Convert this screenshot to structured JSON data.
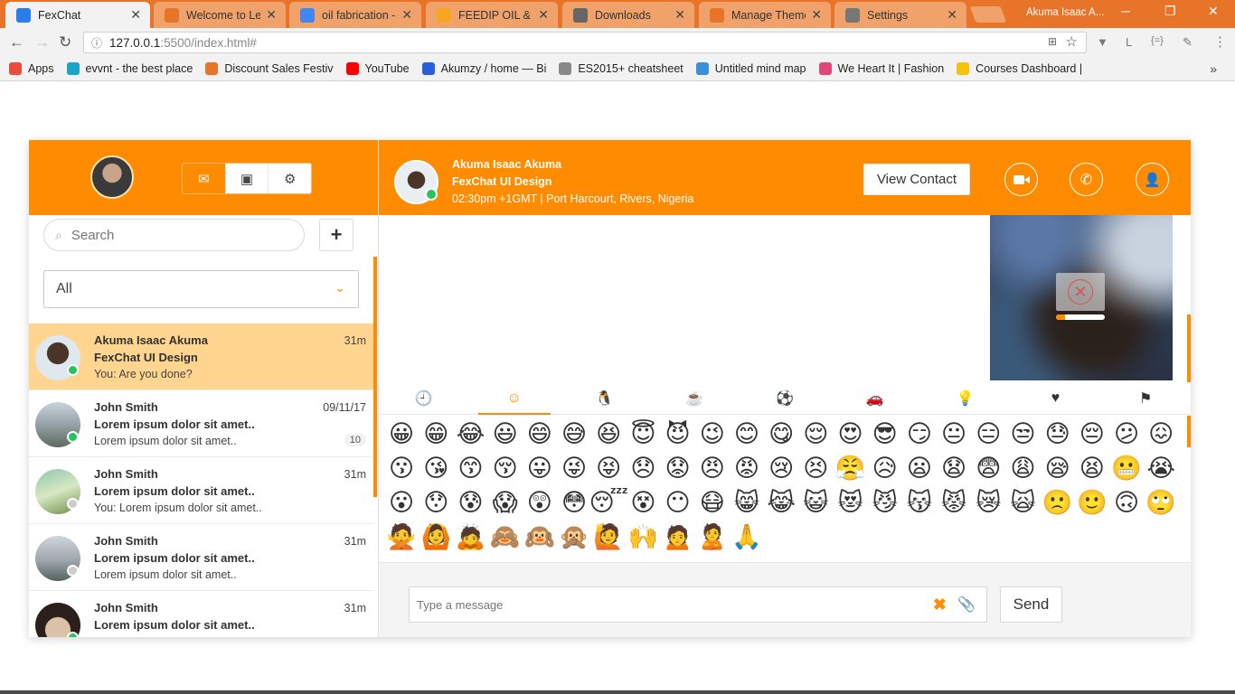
{
  "browser": {
    "tabs": [
      {
        "title": "FexChat",
        "color": "#2b7de9",
        "icon": "document-icon",
        "active": true
      },
      {
        "title": "Welcome to Lee",
        "color": "#e8742a",
        "icon": "brackets-icon"
      },
      {
        "title": "oil fabrication - G",
        "color": "#4285f4",
        "icon": "google-icon"
      },
      {
        "title": "FEEDIP OIL & GA",
        "color": "#f5a623",
        "icon": "feedip-icon"
      },
      {
        "title": "Downloads",
        "color": "#666666",
        "icon": "download-icon"
      },
      {
        "title": "Manage Themes",
        "color": "#e8742a",
        "icon": "brackets-icon"
      },
      {
        "title": "Settings",
        "color": "#777777",
        "icon": "gear-icon"
      }
    ],
    "profile": "Akuma Isaac A...",
    "url_host": "127.0.0.1",
    "url_path": ":5500/index.html#",
    "bookmarks": [
      {
        "label": "Apps",
        "color": "#e74c3c"
      },
      {
        "label": "evvnt - the best place",
        "color": "#1aa5c8"
      },
      {
        "label": "Discount Sales Festiv",
        "color": "#e8742a"
      },
      {
        "label": "YouTube",
        "color": "#ff0000"
      },
      {
        "label": "Akumzy / home — Bi",
        "color": "#2b5fd9"
      },
      {
        "label": "ES2015+ cheatsheet",
        "color": "#888888"
      },
      {
        "label": "Untitled mind map",
        "color": "#3a8fd6"
      },
      {
        "label": "We Heart It | Fashion",
        "color": "#e0457b"
      },
      {
        "label": "Courses Dashboard |",
        "color": "#f4c20d"
      }
    ]
  },
  "sidebar": {
    "search_placeholder": "Search",
    "filter_value": "All",
    "add_label": "+",
    "conversations": [
      {
        "name": "Akuma Isaac Akuma",
        "subject": "FexChat UI Design",
        "preview": "You: Are you done?",
        "time": "31m",
        "online": true,
        "selected": true,
        "count": ""
      },
      {
        "name": "John Smith",
        "subject": "Lorem ipsum dolor sit amet..",
        "preview": "Lorem ipsum dolor sit amet..",
        "time": "09/11/17",
        "online": true,
        "selected": false,
        "count": "10"
      },
      {
        "name": "John Smith",
        "subject": "Lorem ipsum dolor sit amet..",
        "preview": "You: Lorem ipsum dolor sit amet..",
        "time": "31m",
        "online": false,
        "selected": false,
        "count": ""
      },
      {
        "name": "John Smith",
        "subject": "Lorem ipsum dolor sit amet..",
        "preview": "Lorem ipsum dolor sit amet..",
        "time": "31m",
        "online": false,
        "selected": false,
        "count": ""
      },
      {
        "name": "John Smith",
        "subject": "Lorem ipsum dolor sit amet..",
        "preview": "",
        "time": "31m",
        "online": true,
        "selected": false,
        "count": ""
      }
    ]
  },
  "chat": {
    "contact_name": "Akuma Isaac Akuma",
    "contact_subject": "FexChat UI Design",
    "contact_time": "02:30pm +1GMT | Port Harcourt, Rivers, Nigeria",
    "view_contact_label": "View Contact",
    "video_progress": 0.18,
    "emoji_tabs": [
      "clock-icon",
      "smiley-icon",
      "animal-icon",
      "food-icon",
      "ball-icon",
      "car-icon",
      "bulb-icon",
      "heart-icon",
      "flag-icon"
    ],
    "emoji_tab_glyphs": [
      "🕘",
      "☺",
      "🐧",
      "☕",
      "⚽",
      "🚗",
      "💡",
      "♥",
      "⚑"
    ],
    "emojis": "😀😁😂😃😄😅😆😇😈😉😊😋😌😍😎😏😐😑😒😓😔😕😖😗😘😙😚😛😜😝😞😟😠😡😢😣😤😥😦😧😨😩😪😫😬😭😮😯😰😱😲😳😴😵😶😷😸😹😺😻😼😽😾😿🙀🙁🙂🙃🙄🙅🙆🙇🙈🙉🙊🙋🙌🙍🙎🙏",
    "message_placeholder": "Type a message",
    "send_label": "Send"
  },
  "colors": {
    "accent": "#ff8c00",
    "online": "#22c55e",
    "offline": "#cccccc",
    "selected_row": "#ffd590"
  }
}
